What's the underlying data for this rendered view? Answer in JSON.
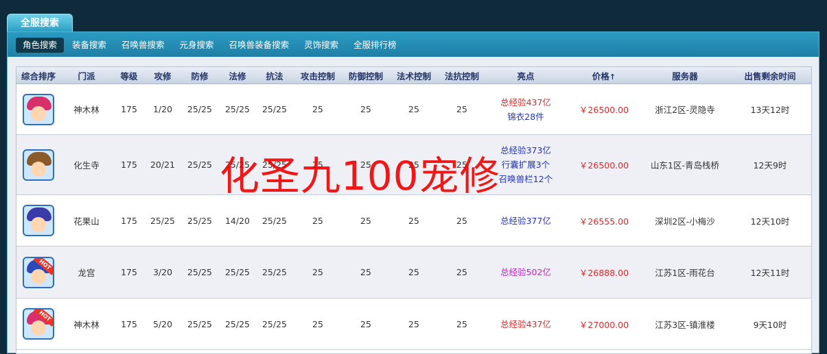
{
  "top_tab": "全服搜索",
  "subnav": [
    "角色搜索",
    "装备搜索",
    "召唤兽搜索",
    "元身搜索",
    "召唤兽装备搜索",
    "灵饰搜索",
    "全服排行榜"
  ],
  "table": {
    "headers": [
      "综合排序",
      "门派",
      "等级",
      "攻修",
      "防修",
      "法修",
      "抗法",
      "攻击控制",
      "防御控制",
      "法术控制",
      "法抗控制",
      "亮点",
      "价格",
      "服务器",
      "出售剩余时间"
    ],
    "price_sort_arrow": "↑",
    "rows": [
      {
        "school": "神木林",
        "level": "175",
        "atk": "1/20",
        "def": "25/25",
        "mag": "25/25",
        "res": "25/25",
        "c1": "25",
        "c2": "25",
        "c3": "25",
        "c4": "25",
        "highlights": [
          {
            "text": "总经验437亿",
            "color": "red"
          },
          {
            "text": "锦衣28件",
            "color": "blue"
          }
        ],
        "price": "￥26500.00",
        "server": "浙江2区-灵隐寺",
        "time": "13天12时",
        "hot": false,
        "hair": "#d8306a"
      },
      {
        "school": "化生寺",
        "level": "175",
        "atk": "20/21",
        "def": "25/25",
        "mag": "25/25",
        "res": "25/25",
        "c1": "25",
        "c2": "25",
        "c3": "25",
        "c4": "25",
        "highlights": [
          {
            "text": "总经验373亿",
            "color": "blue"
          },
          {
            "text": "行囊扩展3个",
            "color": "blue"
          },
          {
            "text": "召唤兽栏12个",
            "color": "blue"
          }
        ],
        "price": "￥26500.00",
        "server": "山东1区-青岛栈桥",
        "time": "12天9时",
        "hot": false,
        "hair": "#8a5a2a"
      },
      {
        "school": "花果山",
        "level": "175",
        "atk": "25/25",
        "def": "25/25",
        "mag": "14/20",
        "res": "25/25",
        "c1": "25",
        "c2": "25",
        "c3": "25",
        "c4": "25",
        "highlights": [
          {
            "text": "总经验377亿",
            "color": "blue"
          }
        ],
        "price": "￥26555.00",
        "server": "深圳2区-小梅沙",
        "time": "12天10时",
        "hot": false,
        "hair": "#3a3aa8"
      },
      {
        "school": "龙宫",
        "level": "175",
        "atk": "3/20",
        "def": "25/25",
        "mag": "25/25",
        "res": "25/25",
        "c1": "25",
        "c2": "25",
        "c3": "25",
        "c4": "25",
        "highlights": [
          {
            "text": "总经验502亿",
            "color": "purple"
          }
        ],
        "price": "￥26888.00",
        "server": "江苏1区-雨花台",
        "time": "12天11时",
        "hot": true,
        "hair": "#2a4ab8"
      },
      {
        "school": "神木林",
        "level": "175",
        "atk": "5/20",
        "def": "25/25",
        "mag": "25/25",
        "res": "25/25",
        "c1": "25",
        "c2": "25",
        "c3": "25",
        "c4": "25",
        "highlights": [
          {
            "text": "总经验437亿",
            "color": "red"
          }
        ],
        "price": "￥27000.00",
        "server": "江苏3区-镇淮楼",
        "time": "9天10时",
        "hot": true,
        "hair": "#d8306a"
      }
    ]
  },
  "watermark": "化圣九100宠修"
}
